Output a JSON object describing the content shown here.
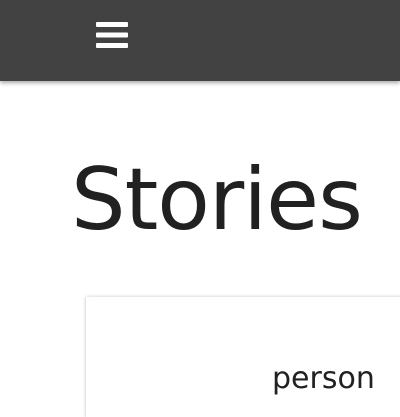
{
  "header": {
    "background": "#424242",
    "menu_icon": "hamburger-menu-icon"
  },
  "main": {
    "title": "Stories",
    "card": {
      "label": "person"
    }
  },
  "colors": {
    "text": "#212121",
    "background": "#ffffff"
  }
}
